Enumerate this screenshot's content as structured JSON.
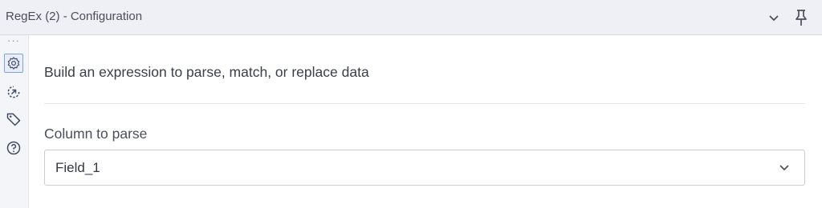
{
  "window": {
    "title": "RegEx (2) - Configuration",
    "collapse_icon": "chevron-down-icon",
    "pin_icon": "pin-icon"
  },
  "sidebar": {
    "more_glyph": "···",
    "items": [
      {
        "icon": "gear-icon",
        "active": true
      },
      {
        "icon": "input-output-icon",
        "active": false
      },
      {
        "icon": "tag-icon",
        "active": false
      },
      {
        "icon": "help-icon",
        "active": false
      }
    ]
  },
  "main": {
    "heading": "Build an expression to parse, match, or replace data",
    "column_label": "Column to parse",
    "column_value": "Field_1"
  },
  "colors": {
    "accent": "#7fa3d6",
    "titlebar_bg": "#eef0f6",
    "sidebar_bg": "#f4f5f8"
  }
}
